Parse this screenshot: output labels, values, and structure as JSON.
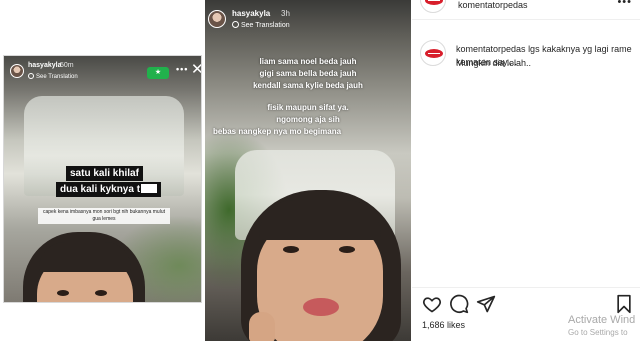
{
  "story_left": {
    "username": "hasyakyla",
    "time": "50m",
    "see_translation": "See Translation",
    "sticker_line1": "satu kali khilaf",
    "sticker_line2": "dua kali kyknya t",
    "caption": "capek kena imbasnya mon sori bgt nih bukannya mulut gua lemes"
  },
  "story_right": {
    "username": "hasyakyla",
    "time": "3h",
    "see_translation": "See Translation",
    "lines": [
      "liam sama noel beda jauh",
      "gigi sama bella beda jauh",
      "kendall sama kylie beda jauh",
      "fisik maupun sifat ya.",
      "ngomong aja sih",
      "bebas nangkep nya mo begimana"
    ]
  },
  "instagram": {
    "post_account": "komentatorpedas",
    "comment_user": "komentatorpedas",
    "comment_text": "lgs kakaknya yg lagi rame kemaren say....",
    "comment_text2": "Mungkin dia lelah..",
    "likes": "1,686 likes",
    "brand_color": "#d81e2b"
  },
  "watermark": {
    "line1": "Activate Wind",
    "line2": "Go to Settings to"
  },
  "icons": [
    "heart-icon",
    "comment-icon",
    "share-icon",
    "bookmark-icon",
    "globe-icon",
    "more-icon",
    "close-icon"
  ]
}
